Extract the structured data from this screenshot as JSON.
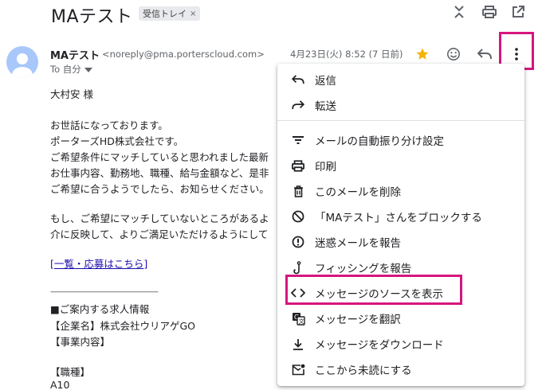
{
  "subject": {
    "title": "MAテスト",
    "label": "受信トレイ",
    "label_close": "×"
  },
  "icons": {
    "collapse": "unfold-less-icon",
    "print": "print-icon",
    "open_new": "open-in-new-icon",
    "star": "star-icon",
    "emoji": "emoji-icon",
    "reply": "reply-icon",
    "more": "more-vert-icon"
  },
  "colors": {
    "star": "#f4b400",
    "highlight": "#d6157e",
    "link": "#1a0dab"
  },
  "message": {
    "sender_name": "MAテスト",
    "sender_email": "<noreply@pma.porterscloud.com>",
    "to": "To 自分",
    "date": "4月23日(火) 8:52 (7 日前)"
  },
  "body": {
    "greeting": "大村安 様",
    "line1": "お世話になっております。",
    "line2": "ポーターズHD株式会社です。",
    "line3": "ご希望条件にマッチしていると思われました最新",
    "line4": "お仕事内容、勤務地、職種、給与金額など、是非",
    "line5": "ご希望に合うようでしたら、お知らせください。",
    "line6": "もし、ご希望にマッチしていないところがあるよ",
    "line7": "介に反映して、よりご満足いただけるようにして",
    "link": "[一覧・応募はこちら]",
    "divider": "------------------------------------------------------------",
    "job_info": "■ご案内する求人情報",
    "company": "【企業名】株式会社ウリアゲGO",
    "business": "【事業内容】",
    "job_type": "【職種】",
    "job_code": "A10"
  },
  "menu": {
    "items": [
      {
        "label": "返信",
        "icon": "reply-icon"
      },
      {
        "label": "転送",
        "icon": "forward-icon"
      },
      {
        "label": "メールの自動振り分け設定",
        "icon": "filter-icon"
      },
      {
        "label": "印刷",
        "icon": "print-icon"
      },
      {
        "label": "このメールを削除",
        "icon": "trash-icon"
      },
      {
        "label": "「MAテスト」さんをブロックする",
        "icon": "block-icon"
      },
      {
        "label": "迷惑メールを報告",
        "icon": "spam-icon"
      },
      {
        "label": "フィッシングを報告",
        "icon": "phishing-icon"
      },
      {
        "label": "メッセージのソースを表示",
        "icon": "code-icon"
      },
      {
        "label": "メッセージを翻訳",
        "icon": "translate-icon"
      },
      {
        "label": "メッセージをダウンロード",
        "icon": "download-icon"
      },
      {
        "label": "ここから未読にする",
        "icon": "mark-unread-icon"
      }
    ]
  }
}
